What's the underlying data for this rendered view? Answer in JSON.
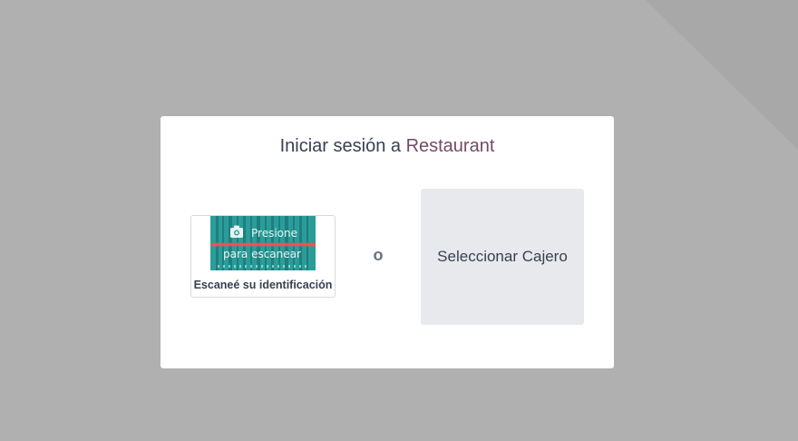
{
  "dialog": {
    "title_prefix": "Iniciar sesión a ",
    "title_brand": "Restaurant"
  },
  "scan": {
    "overlay_line1": "Presione",
    "overlay_line2": "para escanear",
    "caption": "Escaneé su identificación",
    "icon": "camera-icon"
  },
  "separator": "o",
  "cashier_button": {
    "label": "Seleccionar Cajero"
  },
  "colors": {
    "backdrop": "#b0b0b0",
    "brand": "#714b67",
    "scan_teal": "#2a9d9a",
    "scan_line": "#ff4d4d",
    "button_bg": "#e7e9ed"
  }
}
